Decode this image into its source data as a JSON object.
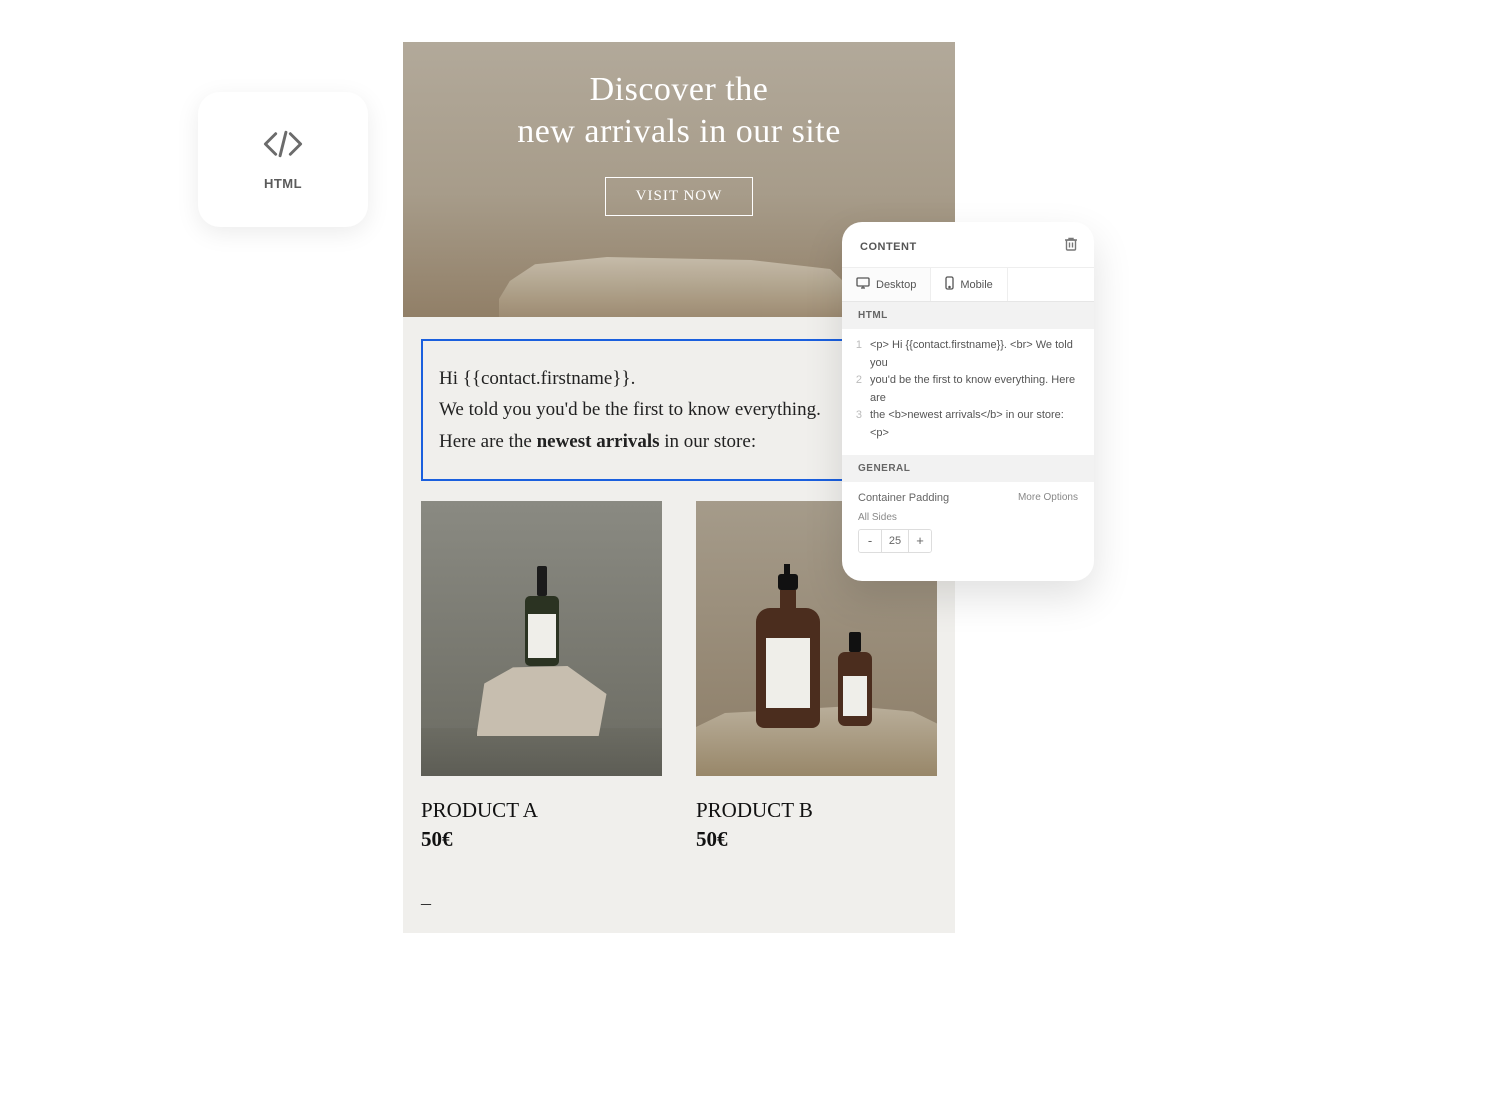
{
  "htmlCard": {
    "label": "HTML"
  },
  "hero": {
    "title_line1": "Discover the",
    "title_line2": "new arrivals in our site",
    "cta": "VISIT NOW"
  },
  "message": {
    "line1": "Hi {{contact.firstname}}.",
    "line2": "We told you you'd be the first to know everything.",
    "line3_prefix": "Here are the ",
    "line3_bold": "newest arrivals",
    "line3_suffix": " in our store:"
  },
  "products": [
    {
      "name": "PRODUCT A",
      "price": "50€"
    },
    {
      "name": "PRODUCT B",
      "price": "50€"
    }
  ],
  "dash": "–",
  "panel": {
    "title": "CONTENT",
    "tabs": {
      "desktop": "Desktop",
      "mobile": "Mobile"
    },
    "html_section": "HTML",
    "code": {
      "n1": "1",
      "n2": "2",
      "n3": "3",
      "l1": "<p> Hi {{contact.firstname}}. <br> We told you",
      "l2": "you'd be the first to know everything. Here are",
      "l3": "the <b>newest arrivals</b> in our store: <p>"
    },
    "general_section": "GENERAL",
    "container_padding": "Container Padding",
    "more_options": "More Options",
    "all_sides": "All Sides",
    "padding_value": "25",
    "minus": "-",
    "plus": "+"
  }
}
